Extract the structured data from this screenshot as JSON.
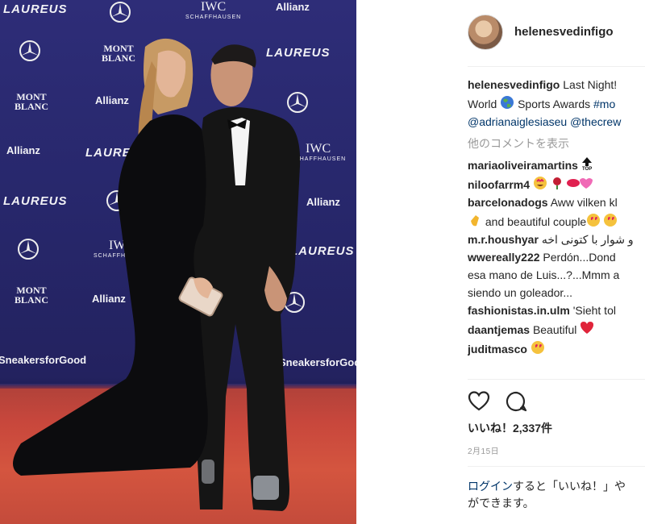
{
  "photo": {
    "alt": "",
    "backdrop_logos": {
      "laureus": "LAUREUS",
      "allianz": "Allianz",
      "mont_blanc": [
        "MONT",
        "BLANC"
      ],
      "iwc": "IWC",
      "iwc_sub": "SCHAFFHAUSEN",
      "sneakers": "SneakersforGood"
    },
    "colors": {
      "backdrop": "#27276b",
      "carpet": "#c8473c"
    }
  },
  "post": {
    "username": "helenesvedinfigo",
    "caption": {
      "username": "helenesvedinfigo",
      "text_line1": " Last Night!",
      "text_line2_a": "World ",
      "text_line2_b": " Sports Awards ",
      "hashtag": "#mo",
      "mentions": [
        "@adrianaiglesiaseu",
        "@thecrew"
      ]
    },
    "view_more_comments": "他のコメントを表示",
    "comments": [
      {
        "user": "mariaoliveiramartins",
        "text": ""
      },
      {
        "user": "niloofarrm4",
        "text": ""
      },
      {
        "user": "barcelonadogs",
        "text": "Aww vilken kl",
        "text2": " and beautiful couple"
      },
      {
        "user": "m.r.houshyar",
        "text": "و شوار با کتونی اخه"
      },
      {
        "user": "wwereally222",
        "text": "Perdón...Dond",
        "text2": "esa mano de Luis...?...Mmm a",
        "text3": "siendo un goleador..."
      },
      {
        "user": "fashionistas.in.ulm",
        "text": "'Sieht tol"
      },
      {
        "user": "daantjemas",
        "text": "Beautiful "
      },
      {
        "user": "juditmasco",
        "text": ""
      }
    ],
    "likes": "いいね！2,337件",
    "date": "2月15日",
    "login_note": {
      "link": "ログイン",
      "text_a": "すると「いいね！」や",
      "text_b": "ができます。"
    },
    "icons": [
      "heart-icon",
      "comment-icon",
      "globe-emoji",
      "top-arrow-emoji"
    ],
    "colors": {
      "link": "#003569",
      "muted": "#999999",
      "follow": "#3897f0"
    }
  }
}
